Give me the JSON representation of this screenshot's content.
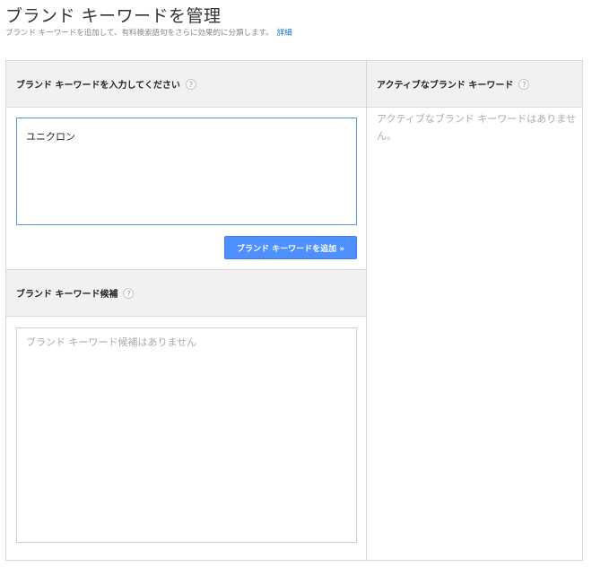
{
  "page": {
    "title": "ブランド キーワードを管理",
    "subtitle": "ブランド キーワードを追加して、有料検索語句をさらに効果的に分類します。",
    "details_link": "詳細"
  },
  "input_section": {
    "header": "ブランド キーワードを入力してください",
    "help_symbol": "?",
    "value": "ユニクロン",
    "add_button_label": "ブランド キーワードを追加 »"
  },
  "candidates_section": {
    "header": "ブランド キーワード候補",
    "help_symbol": "?",
    "empty_text": "ブランド キーワード候補はありません"
  },
  "active_section": {
    "header": "アクティブなブランド キーワード",
    "help_symbol": "?",
    "empty_text": "アクティブなブランド キーワードはありません。"
  },
  "colors": {
    "primary_button": "#4d90fe",
    "input_focus_border": "#5b95db",
    "link": "#1a6dc4",
    "header_background": "#f1f1f1"
  }
}
